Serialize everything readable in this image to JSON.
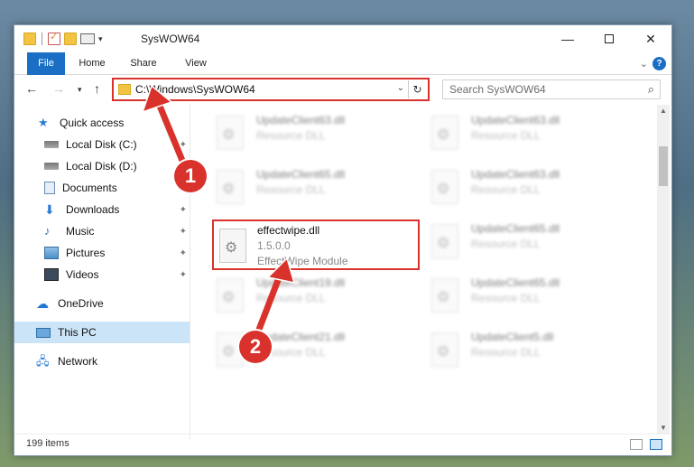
{
  "window": {
    "title": "SysWOW64",
    "controls": {
      "minimize": "—",
      "maximize": "",
      "close": "✕"
    }
  },
  "ribbon": {
    "tabs": [
      "File",
      "Home",
      "Share",
      "View"
    ],
    "expand_icon": "chevron-down-icon",
    "help": "?"
  },
  "nav": {
    "back": "←",
    "forward": "→",
    "recent": "⌄",
    "up": "↑",
    "address": "C:\\Windows\\SysWOW64",
    "refresh": "↻",
    "search_placeholder": "Search SysWOW64",
    "search_icon": "⌕"
  },
  "sidebar": {
    "items": [
      {
        "label": "Quick access",
        "icon": "star-icon",
        "pinned": false
      },
      {
        "label": "Local Disk (C:)",
        "icon": "disk-icon",
        "pinned": true
      },
      {
        "label": "Local Disk (D:)",
        "icon": "disk-icon",
        "pinned": true
      },
      {
        "label": "Documents",
        "icon": "documents-icon",
        "pinned": true
      },
      {
        "label": "Downloads",
        "icon": "downloads-icon",
        "pinned": true
      },
      {
        "label": "Music",
        "icon": "music-icon",
        "pinned": true
      },
      {
        "label": "Pictures",
        "icon": "pictures-icon",
        "pinned": true
      },
      {
        "label": "Videos",
        "icon": "videos-icon",
        "pinned": true
      },
      {
        "label": "OneDrive",
        "icon": "onedrive-icon",
        "pinned": false
      },
      {
        "label": "This PC",
        "icon": "this-pc-icon",
        "pinned": false,
        "selected": true
      },
      {
        "label": "Network",
        "icon": "network-icon",
        "pinned": false
      }
    ],
    "pin_glyph": "📌"
  },
  "files": {
    "highlighted": {
      "name": "effectwipe.dll",
      "version": "1.5.0.0",
      "description": "EffectWipe Module"
    },
    "blurred": [
      {
        "name": "UpdateClient63.dll",
        "type": "Resource DLL"
      },
      {
        "name": "UpdateClient63.dll",
        "type": "Resource DLL"
      },
      {
        "name": "UpdateClient65.dll",
        "type": "Resource DLL"
      },
      {
        "name": "UpdateClient63.dll",
        "type": "Resource DLL"
      },
      {
        "name": "UpdateClient65.dll",
        "type": "Resource DLL"
      },
      {
        "name": "UpdateClient19.dll",
        "type": "Resource DLL"
      },
      {
        "name": "UpdateClient65.dll",
        "type": "Resource DLL"
      },
      {
        "name": "UpdateClient21.dll",
        "type": "Resource DLL"
      },
      {
        "name": "UpdateClient5.dll",
        "type": "Resource DLL"
      }
    ]
  },
  "status": {
    "item_count": "199 items"
  },
  "annotations": {
    "step1": "1",
    "step2": "2",
    "color": "#d9322c"
  }
}
